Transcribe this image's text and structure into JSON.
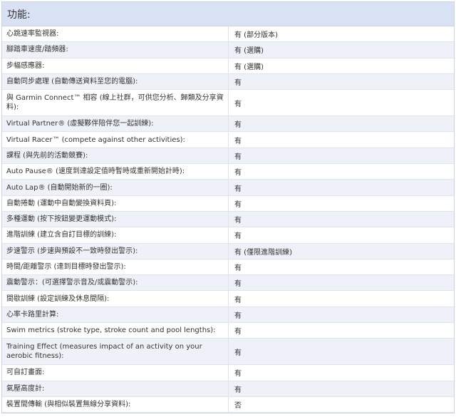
{
  "section": {
    "title": "功能:"
  },
  "rows": [
    {
      "label": "心跳速率監視器:",
      "value": "有 (部分版本)"
    },
    {
      "label": "腳踏車速度/踏頻器:",
      "value": "有 (選購)"
    },
    {
      "label": "步幅感應器:",
      "value": "有 (選購)"
    },
    {
      "label": "自動同步處理 (自動傳送資料至您的電腦):",
      "value": "有"
    },
    {
      "label": "與 Garmin Connect™ 相容 (線上社群，可供您分析、歸類及分享資料):",
      "value": "有",
      "tall": true
    },
    {
      "label": "Virtual Partner® (虛擬夥伴陪伴您一起訓練):",
      "value": "有"
    },
    {
      "label": "Virtual Racer™ (compete against other activities):",
      "value": "有"
    },
    {
      "label": "課程 (與先前的活動競賽):",
      "value": "有"
    },
    {
      "label": "Auto Pause® (速度到達設定值時暫時或重新開始計時):",
      "value": "有"
    },
    {
      "label": "Auto Lap® (自動開始新的一圈):",
      "value": "有"
    },
    {
      "label": "自動捲動 (運動中自動變換資料頁):",
      "value": "有"
    },
    {
      "label": "多種運動 (按下按鈕變更運動模式):",
      "value": "有"
    },
    {
      "label": "進階訓練 (建立含自訂目標的訓練):",
      "value": "有"
    },
    {
      "label": "步速警示 (步速與預設不一致時發出警示):",
      "value": "有 (僅限進階訓練)"
    },
    {
      "label": "時間/距離警示 (達到目標時發出警示):",
      "value": "有"
    },
    {
      "label": "震動警示：(可選擇警示音及/或震動警示):",
      "value": "有"
    },
    {
      "label": "間歇訓練 (設定訓練及休息間隔):",
      "value": "有"
    },
    {
      "label": "心率卡路里計算:",
      "value": "有"
    },
    {
      "label": "Swim metrics (stroke type, stroke count and pool lengths):",
      "value": "有"
    },
    {
      "label": "Training Effect (measures impact of an activity on your aerobic fitness):",
      "value": "有",
      "tall": true
    },
    {
      "label": "可自訂畫面:",
      "value": "有"
    },
    {
      "label": "氣壓高度計:",
      "value": "有"
    },
    {
      "label": "裝置間傳輸 (與相似裝置無線分享資料):",
      "value": "否"
    }
  ]
}
